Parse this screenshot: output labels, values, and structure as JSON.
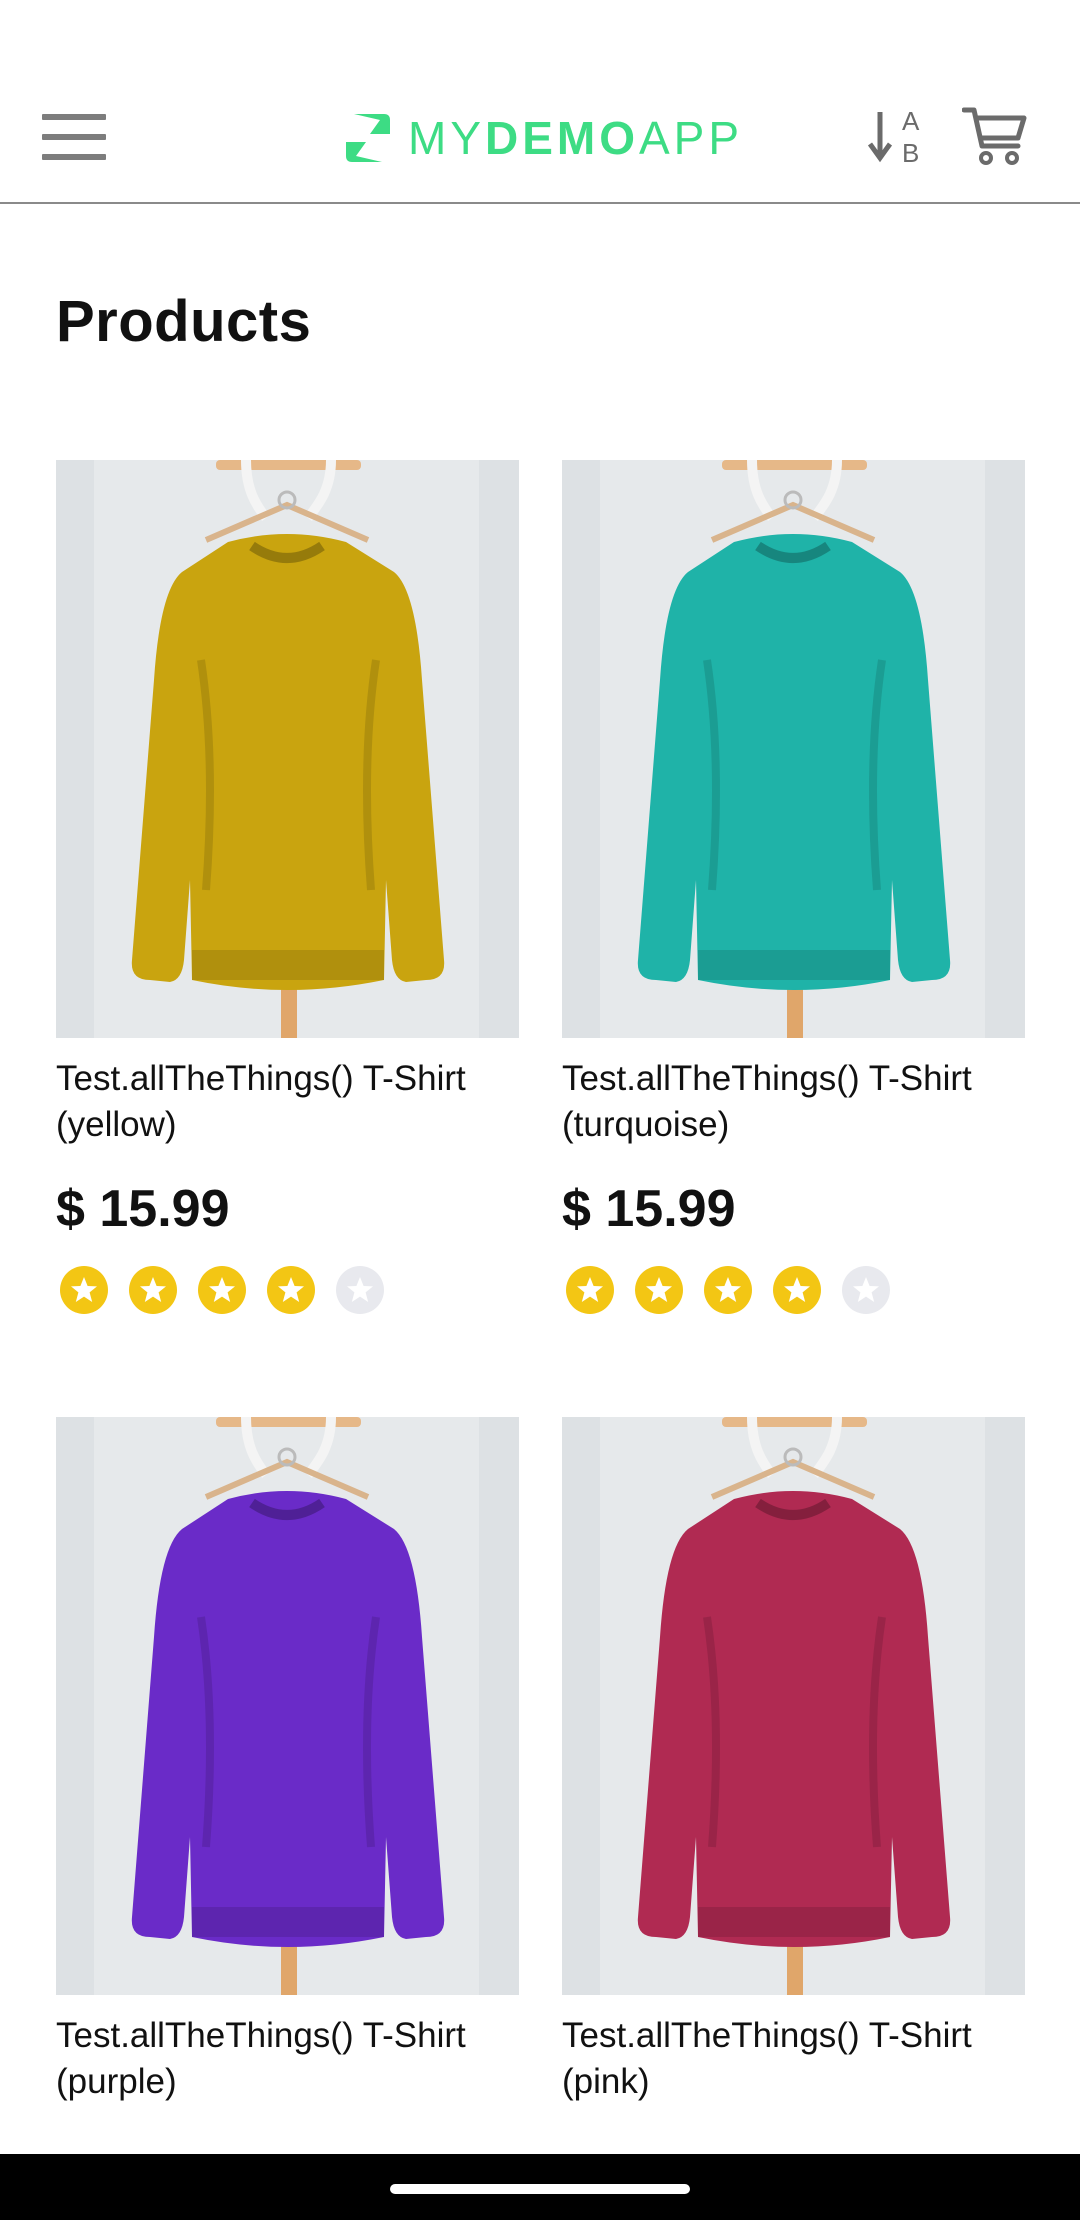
{
  "header": {
    "logo_text_part1": "MY",
    "logo_text_part2": "DEMO",
    "logo_text_part3": "APP",
    "menu_icon": "hamburger-menu-icon",
    "sort_icon": "sort-az-icon",
    "cart_icon": "cart-icon"
  },
  "page": {
    "title": "Products"
  },
  "products": [
    {
      "name": "Test.allTheThings() T-Shirt (yellow)",
      "price": "$ 15.99",
      "rating": 4,
      "max_rating": 5,
      "color": "#c9a40f"
    },
    {
      "name": "Test.allTheThings() T-Shirt (turquoise)",
      "price": "$ 15.99",
      "rating": 4,
      "max_rating": 5,
      "color": "#1fb3a8"
    },
    {
      "name": "Test.allTheThings() T-Shirt (purple)",
      "price": "",
      "rating": 0,
      "max_rating": 5,
      "color": "#6a2bc8"
    },
    {
      "name": "Test.allTheThings() T-Shirt (pink)",
      "price": "",
      "rating": 0,
      "max_rating": 5,
      "color": "#b02a52"
    }
  ],
  "colors": {
    "brand": "#3ddc84",
    "star_filled": "#f3c614",
    "star_empty": "#e8e9ee",
    "divider": "#8a8a8a"
  }
}
